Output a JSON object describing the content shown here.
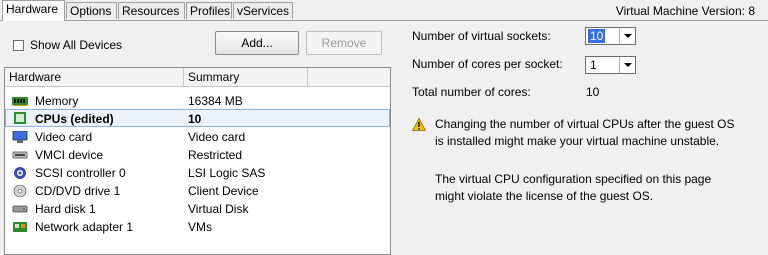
{
  "tabs": [
    "Hardware",
    "Options",
    "Resources",
    "Profiles",
    "vServices"
  ],
  "version_text": "Virtual Machine Version: 8",
  "left": {
    "show_all_devices_label": "Show All Devices",
    "add_button": "Add...",
    "remove_button": "Remove",
    "table": {
      "headers": [
        "Hardware",
        "Summary"
      ],
      "rows": [
        {
          "icon": "memory-icon",
          "name": "Memory",
          "summary": "16384 MB"
        },
        {
          "icon": "cpu-icon",
          "name": "CPUs (edited)",
          "summary": "10",
          "selected": true
        },
        {
          "icon": "video-card-icon",
          "name": "Video card",
          "summary": "Video card"
        },
        {
          "icon": "vmci-icon",
          "name": "VMCI device",
          "summary": "Restricted"
        },
        {
          "icon": "scsi-icon",
          "name": "SCSI controller 0",
          "summary": "LSI Logic SAS"
        },
        {
          "icon": "cd-dvd-icon",
          "name": "CD/DVD drive 1",
          "summary": "Client Device"
        },
        {
          "icon": "hard-disk-icon",
          "name": "Hard disk 1",
          "summary": "Virtual Disk"
        },
        {
          "icon": "network-adapter-icon",
          "name": "Network adapter 1",
          "summary": "VMs"
        }
      ]
    }
  },
  "right": {
    "sockets_label": "Number of virtual sockets:",
    "sockets_value": "10",
    "cores_label": "Number of cores per socket:",
    "cores_value": "1",
    "total_label": "Total number of cores:",
    "total_value": "10",
    "warning_line1": "Changing the number of virtual CPUs after the guest OS",
    "warning_line2": "is installed might make your virtual machine unstable.",
    "license_line1": "The virtual CPU configuration specified on this page",
    "license_line2": "might violate the license of the guest OS."
  },
  "colors": {
    "selection": "#eaf2fc",
    "highlight": "#3a6ee0",
    "warning": "#f2c200"
  }
}
